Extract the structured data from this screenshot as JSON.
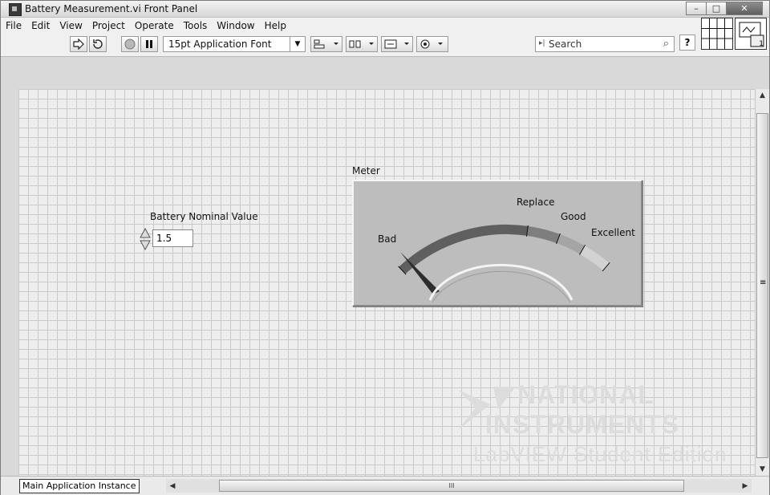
{
  "window": {
    "title": "Battery Measurement.vi Front Panel",
    "minimize_glyph": "–",
    "maximize_glyph": "□",
    "close_glyph": "✕"
  },
  "menu": [
    "File",
    "Edit",
    "View",
    "Project",
    "Operate",
    "Tools",
    "Window",
    "Help"
  ],
  "toolbar": {
    "font_label": "15pt Application Font",
    "search_placeholder": "Search",
    "help_glyph": "?",
    "connector_number": "1"
  },
  "controls": {
    "battery_label": "Battery Nominal Value",
    "battery_value": "1.5"
  },
  "meter": {
    "label": "Meter",
    "scale_labels": [
      "Bad",
      "Replace",
      "Good",
      "Excellent"
    ],
    "needle_position": "Bad",
    "colors": {
      "bad": "#5f5f5f",
      "replace": "#7e7e7e",
      "good": "#a5a5a5",
      "excellent": "#d2d2d2"
    }
  },
  "watermark": {
    "line1": "NATIONAL",
    "line2": "INSTRUMENTS",
    "line3": "LabVIEW Student Edition"
  },
  "status": {
    "instance": "Main Application Instance",
    "scroll_mark": "III"
  }
}
